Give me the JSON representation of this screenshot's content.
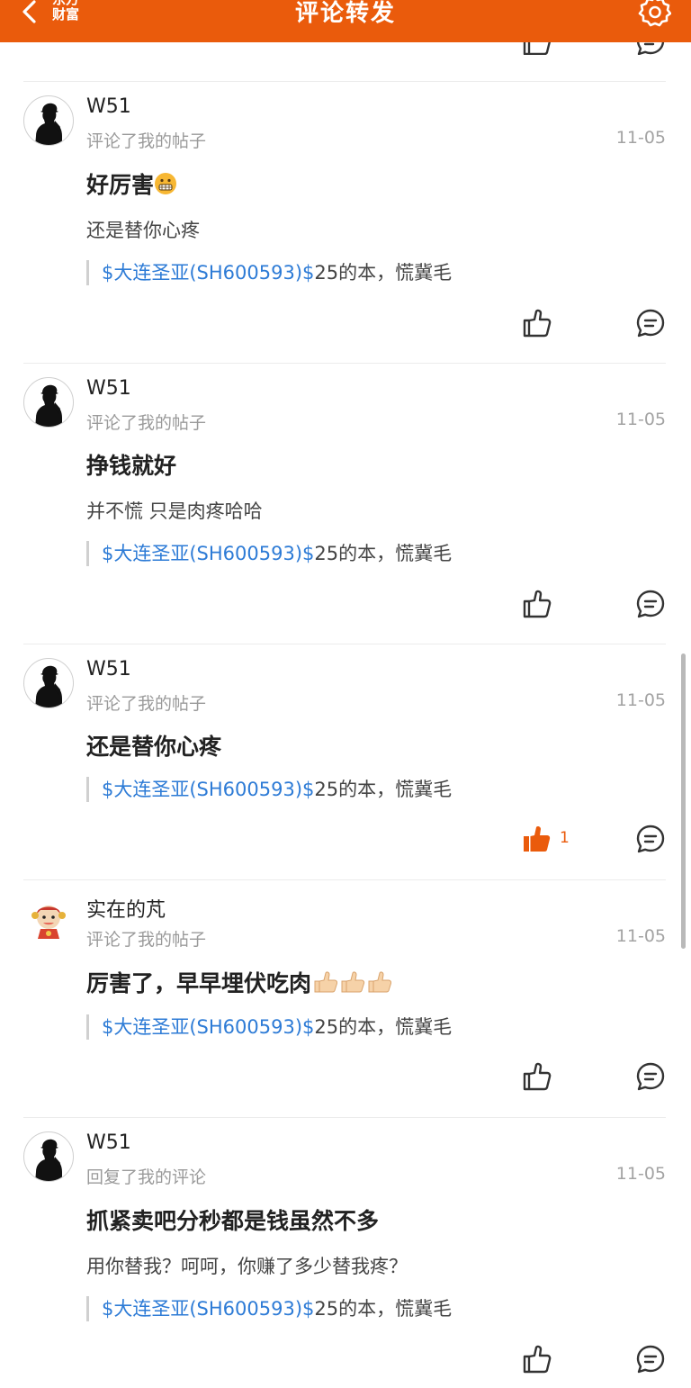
{
  "topbar": {
    "brand_line1": "东方",
    "brand_line2": "财富",
    "title": "评论转发",
    "accent_color": "#ea5b0c"
  },
  "icons": {
    "back": "chevron-left-icon",
    "settings": "gear-icon",
    "like": "thumbs-up-icon",
    "reply": "comment-bubble-icon"
  },
  "items": [
    {
      "username": "W51",
      "action": "评论了我的帖子",
      "date": "11-05",
      "comment": "好厉害",
      "comment_emoji": "grimacing-face",
      "reply": "还是替你心疼",
      "quote_stock": "$大连圣亚(SH600593)$",
      "quote_text": "25的本，慌冀毛",
      "likes": ""
    },
    {
      "username": "W51",
      "action": "评论了我的帖子",
      "date": "11-05",
      "comment": "挣钱就好",
      "reply": "并不慌 只是肉疼哈哈",
      "quote_stock": "$大连圣亚(SH600593)$",
      "quote_text": "25的本，慌冀毛",
      "likes": ""
    },
    {
      "username": "W51",
      "action": "评论了我的帖子",
      "date": "11-05",
      "comment": "还是替你心疼",
      "quote_stock": "$大连圣亚(SH600593)$",
      "quote_text": "25的本，慌冀毛",
      "likes": "1",
      "liked": true
    },
    {
      "username": "实在的芃",
      "action": "评论了我的帖子",
      "date": "11-05",
      "comment": "厉害了，早早埋伏吃肉",
      "comment_emoji": "thumbs-up x3",
      "quote_stock": "$大连圣亚(SH600593)$",
      "quote_text": "25的本，慌冀毛",
      "likes": ""
    },
    {
      "username": "W51",
      "action": "回复了我的评论",
      "date": "11-05",
      "comment": "抓紧卖吧分秒都是钱虽然不多",
      "reply": "用你替我？呵呵，你赚了多少替我疼？",
      "quote_stock": "$大连圣亚(SH600593)$",
      "quote_text": "25的本，慌冀毛",
      "likes": ""
    }
  ]
}
